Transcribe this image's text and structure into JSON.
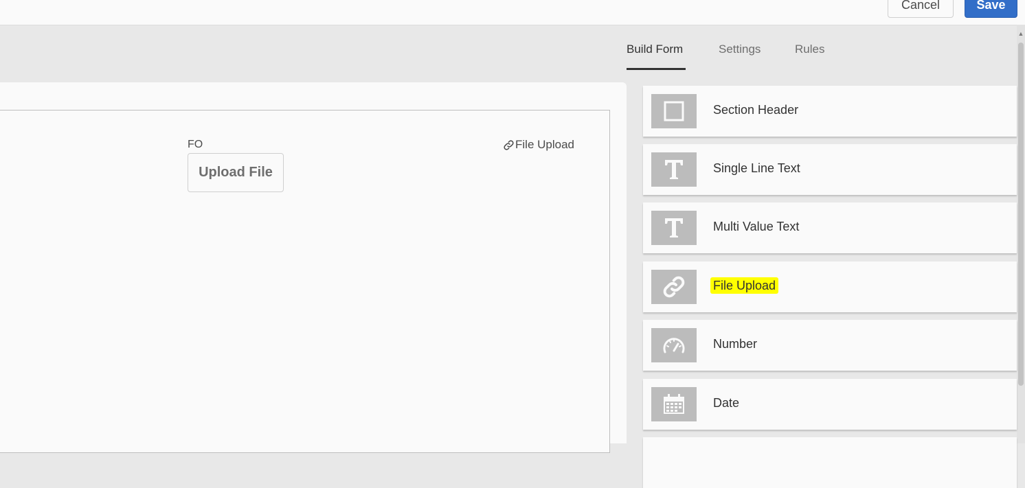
{
  "header": {
    "cancel_label": "Cancel",
    "save_label": "Save"
  },
  "tabs": [
    {
      "label": "Build Form",
      "active": true
    },
    {
      "label": "Settings",
      "active": false
    },
    {
      "label": "Rules",
      "active": false
    }
  ],
  "canvas": {
    "field_label": "FO",
    "upload_button_label": "Upload File",
    "field_type_tag": "File Upload",
    "field_type_icon": "link-icon"
  },
  "components": [
    {
      "label": "Section Header",
      "icon": "section-header-icon",
      "highlighted": false
    },
    {
      "label": "Single Line Text",
      "icon": "text-icon",
      "highlighted": false
    },
    {
      "label": "Multi Value Text",
      "icon": "text-icon",
      "highlighted": false
    },
    {
      "label": "File Upload",
      "icon": "link-icon",
      "highlighted": true
    },
    {
      "label": "Number",
      "icon": "gauge-icon",
      "highlighted": false
    },
    {
      "label": "Date",
      "icon": "calendar-icon",
      "highlighted": false
    }
  ],
  "colors": {
    "primary_button": "#326ec8",
    "highlight": "#ffff00",
    "icon_tile": "#bcbcbc"
  }
}
